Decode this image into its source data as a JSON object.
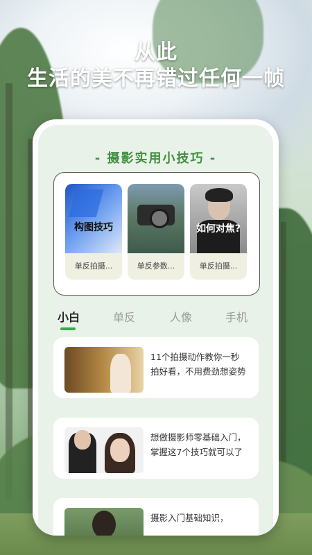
{
  "headline": {
    "line1": "从此",
    "line2": "生活的美不再错过任何一帧"
  },
  "section_title": "- 摄影实用小技巧 -",
  "tips": [
    {
      "overlay": "构图技巧",
      "caption": "单反拍摄..."
    },
    {
      "overlay": "",
      "caption": "单反参数..."
    },
    {
      "overlay": "如何对焦?",
      "caption": "单反拍摄..."
    }
  ],
  "tabs": [
    {
      "label": "小白",
      "active": true
    },
    {
      "label": "单反",
      "active": false
    },
    {
      "label": "人像",
      "active": false
    },
    {
      "label": "手机",
      "active": false
    }
  ],
  "articles": [
    {
      "text": "11个拍摄动作教你一秒拍好看，不用费劲想姿势"
    },
    {
      "text": "想做摄影师零基础入门，掌握这7个技巧就可以了"
    },
    {
      "text": "摄影入门基础知识，"
    }
  ],
  "colors": {
    "accent": "#3fa64a",
    "title_green": "#3f8f3f",
    "screen_bg": "#e9f2e8"
  }
}
